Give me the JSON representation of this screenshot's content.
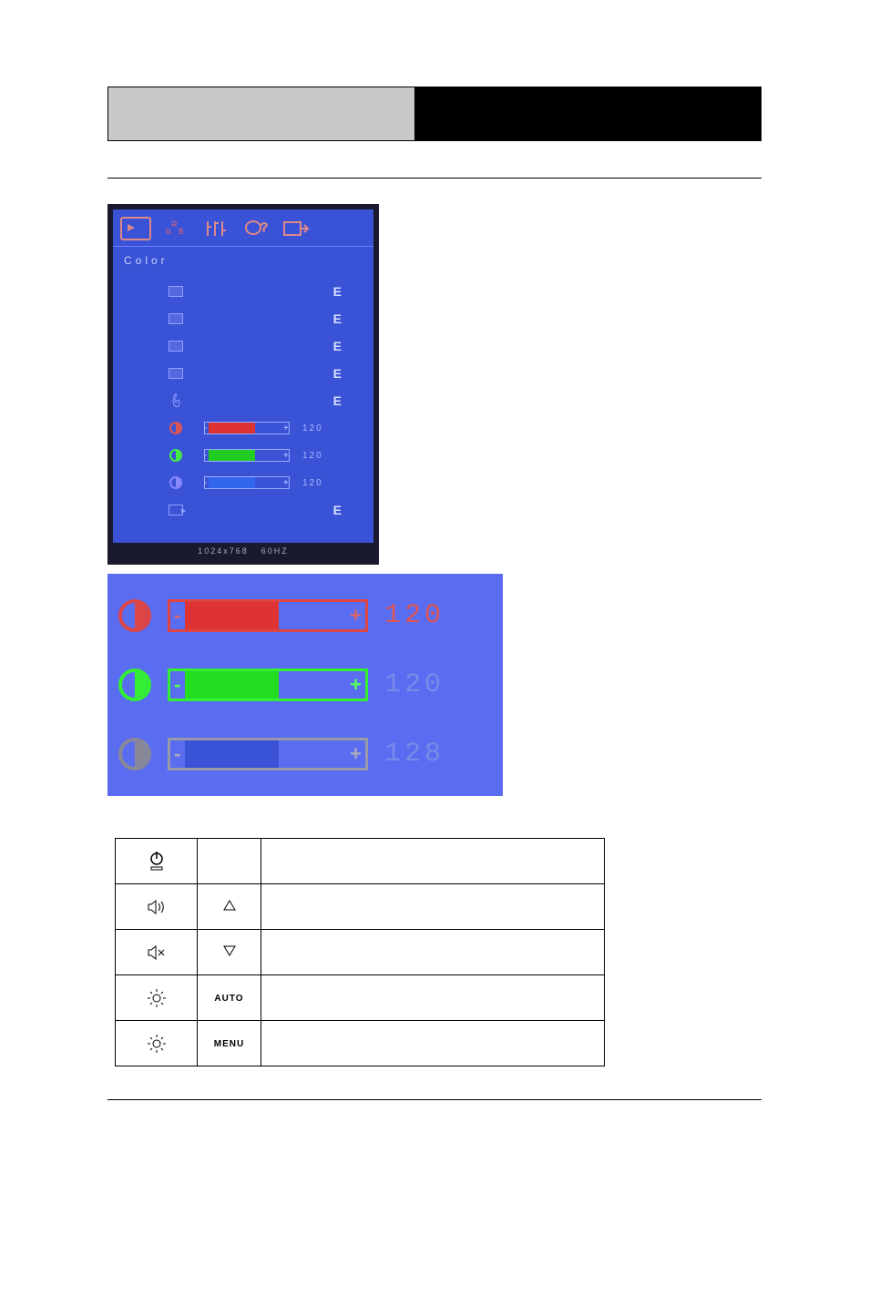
{
  "osd": {
    "title": "Color",
    "tabs": [
      "picture",
      "rgb",
      "tools",
      "language",
      "exit"
    ],
    "presets": [
      {
        "kind": "box",
        "epsilon": "E"
      },
      {
        "kind": "box",
        "epsilon": "E"
      },
      {
        "kind": "box",
        "epsilon": "E"
      },
      {
        "kind": "box",
        "epsilon": "E"
      },
      {
        "kind": "flame",
        "epsilon": "E"
      }
    ],
    "channels": [
      {
        "name": "red",
        "value": "120"
      },
      {
        "name": "green",
        "value": "120"
      },
      {
        "name": "blue",
        "value": "120"
      }
    ],
    "exit_epsilon": "E",
    "footer": {
      "resolution": "1024x768",
      "refresh": "60HZ"
    }
  },
  "zoom": {
    "rows": [
      {
        "name": "red",
        "value": "120",
        "dim": false
      },
      {
        "name": "green",
        "value": "120",
        "dim": true
      },
      {
        "name": "blue",
        "value": "128",
        "dim": true
      }
    ]
  },
  "controls": {
    "rows": [
      {
        "icon": "power",
        "button": "",
        "desc": ""
      },
      {
        "icon": "speaker-on",
        "button": "up",
        "desc": ""
      },
      {
        "icon": "speaker-off",
        "button": "down",
        "desc": ""
      },
      {
        "icon": "brightness",
        "button": "AUTO",
        "desc": ""
      },
      {
        "icon": "brightness",
        "button": "MENU",
        "desc": ""
      }
    ]
  }
}
